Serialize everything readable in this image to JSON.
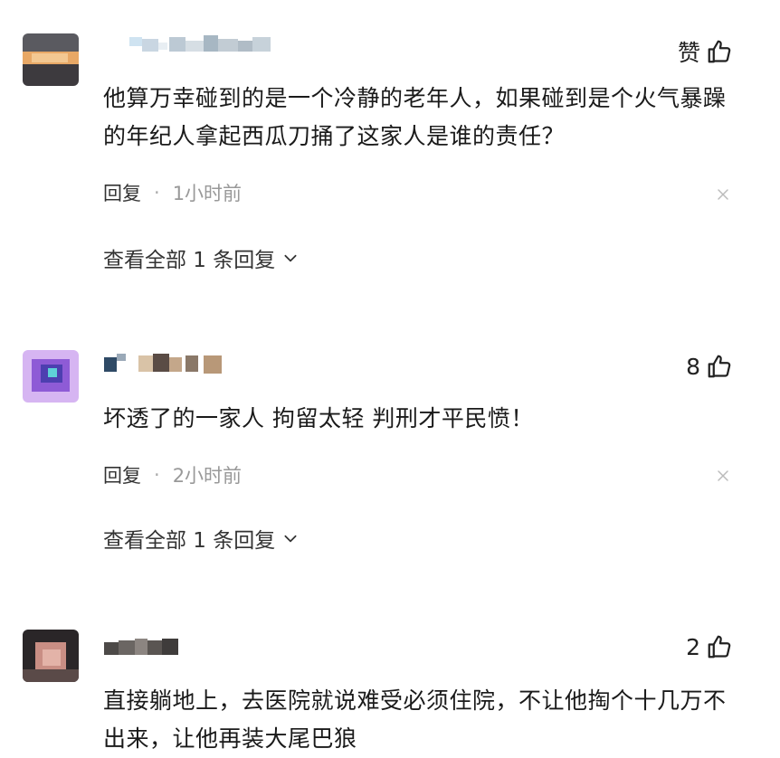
{
  "comments": [
    {
      "like_label": "赞",
      "text": "他算万幸碰到的是一个冷静的老年人，如果碰到是个火气暴躁的年纪人拿起西瓜刀捅了这家人是谁的责任？",
      "reply_label": "回复",
      "time": "1小时前",
      "expand_label": "查看全部 1 条回复"
    },
    {
      "like_label": "8",
      "text": "坏透了的一家人 拘留太轻 判刑才平民愤！",
      "reply_label": "回复",
      "time": "2小时前",
      "expand_label": "查看全部 1 条回复"
    },
    {
      "like_label": "2",
      "text": "直接躺地上，去医院就说难受必须住院，不让他掏个十几万不出来，让他再装大尾巴狼",
      "reply_label": "回复",
      "time": "",
      "expand_label": ""
    }
  ],
  "colors": {
    "text": "#1a1a1a",
    "meta": "#999999",
    "close": "#bbbbbb"
  },
  "icons": {
    "like": "thumbs-up-icon",
    "close": "close-icon",
    "expand": "chevron-down-icon"
  }
}
